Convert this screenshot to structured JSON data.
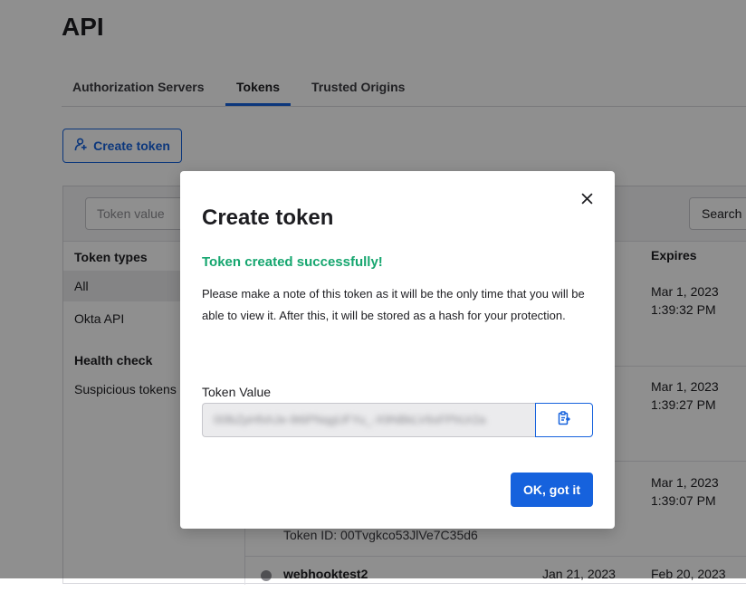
{
  "page": {
    "title": "API"
  },
  "tabs": [
    {
      "label": "Authorization Servers"
    },
    {
      "label": "Tokens"
    },
    {
      "label": "Trusted Origins"
    }
  ],
  "toolbar": {
    "create_token_label": "Create token"
  },
  "filter": {
    "placeholder": "Token value",
    "search_label": "Search"
  },
  "sidebar": {
    "token_types_heading": "Token types",
    "items": [
      {
        "label": "All"
      },
      {
        "label": "Okta API"
      }
    ],
    "health_heading": "Health check",
    "health_items": [
      {
        "label": "Suspicious tokens"
      }
    ]
  },
  "table": {
    "expires_header": "Expires",
    "rows": [
      {
        "expires_date": "Mar 1, 2023",
        "expires_time": "1:39:32 PM"
      },
      {
        "expires_date": "Mar 1, 2023",
        "expires_time": "1:39:27 PM"
      },
      {
        "expires_date": "Mar 1, 2023",
        "expires_time": "1:39:07 PM",
        "token_id": "Token ID: 00Tvgkco53JlVe7C35d6"
      },
      {
        "name": "webhooktest2",
        "created": "Jan 21, 2023",
        "expires_date": "Feb 20, 2023"
      }
    ]
  },
  "modal": {
    "title": "Create token",
    "success": "Token created successfully!",
    "note": "Please make a note of this token as it will be the only time that you will be able to view it. After this, it will be stored as a hash for your protection.",
    "token_value_label": "Token Value",
    "token_value": "00lbZpHfxhJe-9t6PNqgUFYu_-X9NBkLV6sFPhUr2a",
    "ok_label": "OK, got it"
  },
  "colors": {
    "accent": "#1662dd",
    "success": "#16a66f",
    "overlay": "rgba(0,0,0,0.44)"
  },
  "icons": {
    "create": "add-user-icon",
    "close": "close-icon",
    "copy": "clipboard-icon"
  }
}
